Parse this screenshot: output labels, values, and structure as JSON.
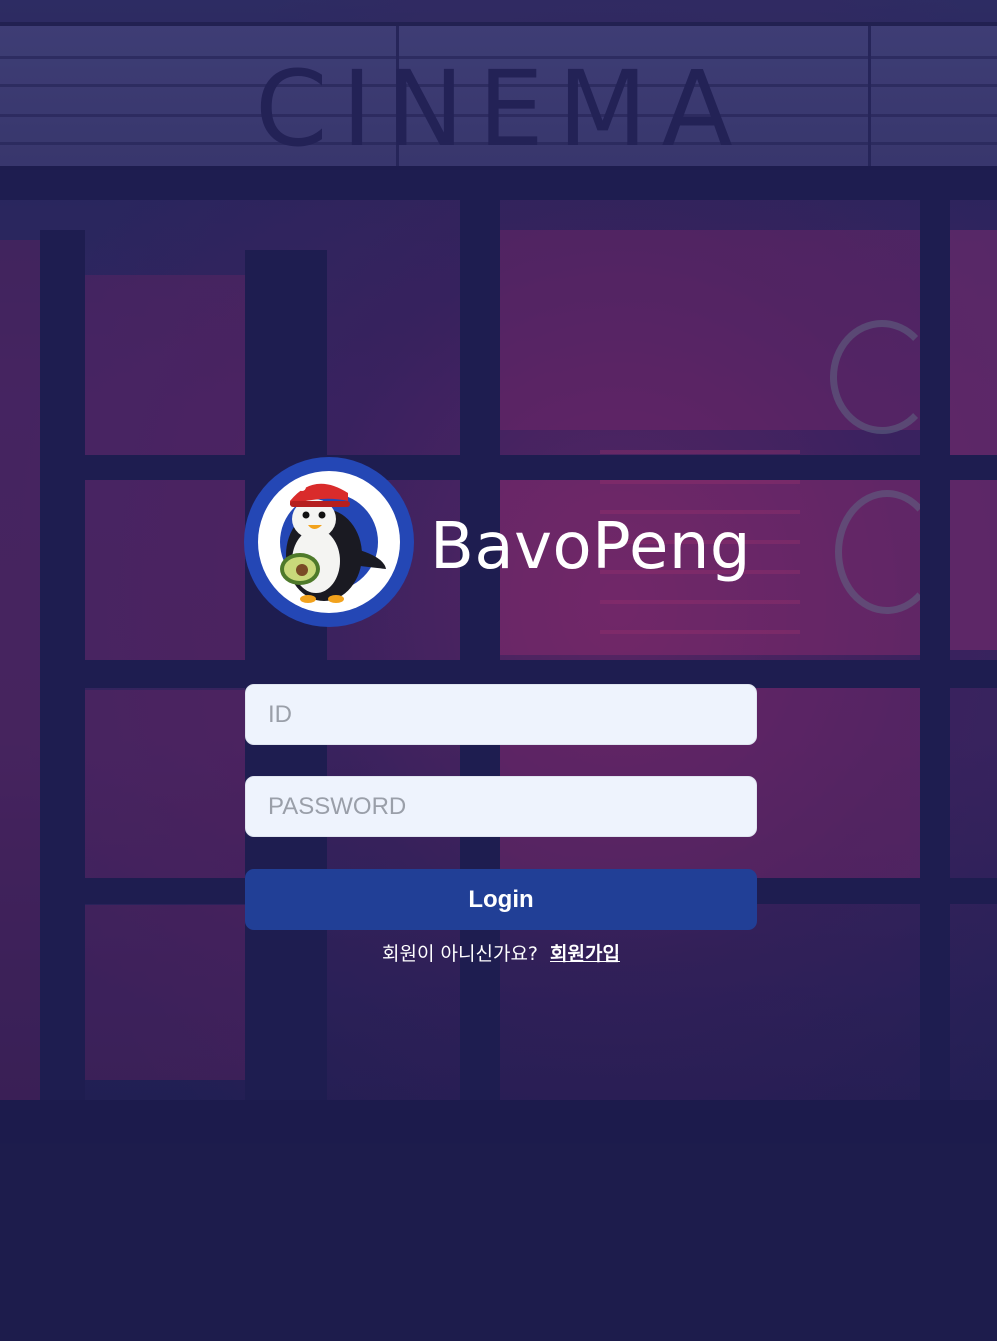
{
  "background": {
    "sign_text": "CINEMA",
    "colors": {
      "overlay": "#1e1d4c",
      "neon_pink": "#a0286e"
    }
  },
  "brand": {
    "name": "BavoPeng",
    "logo_icon": "penguin-mascot-icon"
  },
  "form": {
    "id_placeholder": "ID",
    "id_value": "",
    "password_placeholder": "PASSWORD",
    "password_value": "",
    "login_label": "Login"
  },
  "signup": {
    "question": "회원이 아니신가요?",
    "link_label": "회원가입"
  },
  "colors": {
    "button": "#213f96",
    "input_bg": "#eef3fd",
    "logo_blue": "#2447b5"
  }
}
